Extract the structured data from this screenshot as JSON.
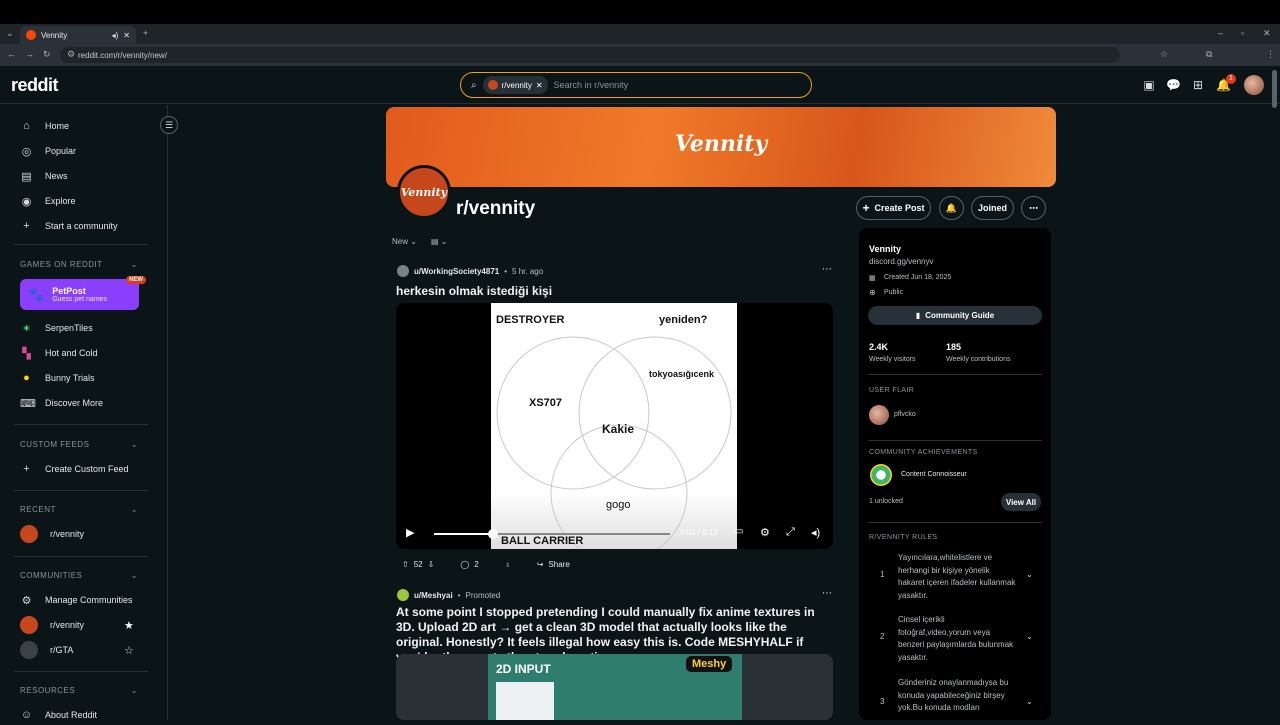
{
  "browser": {
    "tab_title": "Vennity",
    "url": "reddit.com/r/vennity/new/"
  },
  "header": {
    "logo": "reddit",
    "search_chip": "r/vennity",
    "search_placeholder": "Search in r/vennity",
    "notification_count": "1"
  },
  "sidebar": {
    "main": [
      {
        "label": "Home",
        "icon": "home-icon"
      },
      {
        "label": "Popular",
        "icon": "popular-icon"
      },
      {
        "label": "News",
        "icon": "news-icon"
      },
      {
        "label": "Explore",
        "icon": "explore-icon"
      },
      {
        "label": "Start a community",
        "icon": "plus-icon"
      }
    ],
    "games_header": "GAMES ON REDDIT",
    "petpost": {
      "title": "PetPost",
      "subtitle": "Guess pet names",
      "badge": "NEW"
    },
    "games": [
      {
        "label": "SerpenTiles"
      },
      {
        "label": "Hot and Cold"
      },
      {
        "label": "Bunny Trials"
      },
      {
        "label": "Discover More"
      }
    ],
    "custom_feeds_header": "CUSTOM FEEDS",
    "create_custom_feed": "Create Custom Feed",
    "recent_header": "RECENT",
    "recent": [
      {
        "label": "r/vennity"
      }
    ],
    "communities_header": "COMMUNITIES",
    "communities": [
      {
        "label": "Manage Communities"
      },
      {
        "label": "r/vennity"
      },
      {
        "label": "r/GTA"
      }
    ],
    "resources_header": "RESOURCES",
    "resources": [
      {
        "label": "About Reddit"
      }
    ]
  },
  "subreddit": {
    "banner_logo": "Vennity",
    "avatar_text": "Vennity",
    "name": "r/vennity",
    "create_post": "Create Post",
    "joined": "Joined",
    "sort": "New"
  },
  "posts": [
    {
      "user": "u/WorkingSociety4871",
      "time": "5 hr. ago",
      "title": "herkesin olmak istediği kişi",
      "venn_labels": {
        "top_left": "DESTROYER",
        "top_right": "yeniden?",
        "left": "XS707",
        "right": "tokyoasığıcenk",
        "center": "Kakie",
        "bottom": "gogo",
        "bottom_caption": "BALL CARRIER"
      },
      "video_time": "0:03 / 0:12",
      "video_progress": 0.25,
      "votes": "52",
      "comments": "2",
      "share": "Share"
    },
    {
      "user": "u/Meshyai",
      "promoted": "Promoted",
      "title": "At some point I stopped pretending I could manually fix anime textures in 3D. Upload 2D art → get a clean 3D model that actually looks like the original. Honestly? It feels illegal how easy this is. Code MESHYHALF if you'd rather create than tweak vertices.",
      "image_label": "2D INPUT",
      "brand": "Meshy"
    }
  ],
  "about": {
    "name": "Vennity",
    "link": "discord.gg/vennyv",
    "created": "Created Jun 18, 2025",
    "visibility": "Public",
    "guide_button": "Community Guide",
    "weekly_visitors_value": "2.4K",
    "weekly_visitors_label": "Weekly visitors",
    "weekly_contrib_value": "185",
    "weekly_contrib_label": "Weekly contributions",
    "user_flair_header": "USER FLAIR",
    "user_flair_name": "pflvcko",
    "achievements_header": "COMMUNITY ACHIEVEMENTS",
    "achievement_name": "Content Connoisseur",
    "unlocked": "1 unlocked",
    "view_all": "View All",
    "rules_header": "R/VENNITY RULES",
    "rules": [
      {
        "num": "1",
        "text": "Yayıncılara,whitelistlere ve herhangi bir kişiye yönelik hakaret içeren ifadeler kullanmak yasaktır."
      },
      {
        "num": "2",
        "text": "Cinsel içerikli fotoğraf,video,yorum veya benzeri paylaşımlarda bulunmak yasaktır."
      },
      {
        "num": "3",
        "text": "Gönderiniz onaylanmadıysa bu konuda yapabileceğiniz birşey yok.Bu konuda modları"
      }
    ]
  }
}
